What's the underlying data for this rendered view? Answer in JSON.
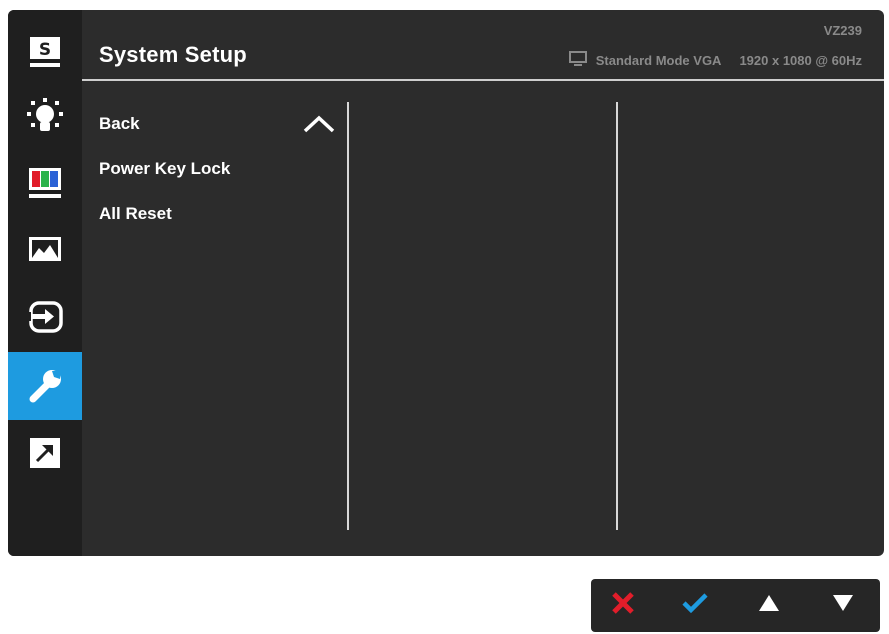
{
  "osd": {
    "title": "System Setup",
    "model": "VZ239",
    "status": {
      "mode": "Standard Mode VGA",
      "resolution": "1920 x 1080 @ 60Hz"
    },
    "sidebar": [
      {
        "icon": "splendid-icon"
      },
      {
        "icon": "brightness-icon"
      },
      {
        "icon": "color-icon"
      },
      {
        "icon": "image-icon"
      },
      {
        "icon": "input-select-icon"
      },
      {
        "icon": "system-setup-icon",
        "selected": true
      },
      {
        "icon": "shortcut-icon"
      }
    ],
    "menu": [
      {
        "label": "Back"
      },
      {
        "label": "Power Key Lock"
      },
      {
        "label": "All Reset"
      }
    ]
  },
  "keys": [
    {
      "icon": "close-icon",
      "color": "#e11d2a"
    },
    {
      "icon": "check-icon",
      "color": "#1e9be0"
    },
    {
      "icon": "up-arrow-icon",
      "color": "#ffffff"
    },
    {
      "icon": "down-arrow-icon",
      "color": "#ffffff"
    }
  ],
  "colors": {
    "accent": "#1e9be0",
    "background": "#2c2c2c",
    "sidebar": "#1f1f1f"
  }
}
